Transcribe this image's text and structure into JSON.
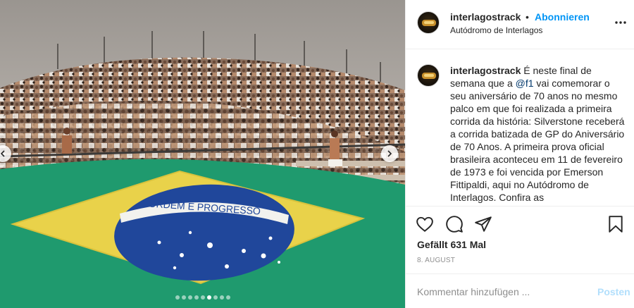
{
  "header": {
    "username": "interlagostrack",
    "separator": "•",
    "follow_label": "Abonnieren",
    "location": "Autódromo de Interlagos"
  },
  "caption": {
    "username": "interlagostrack",
    "text_before_mention": " É neste final de semana que a ",
    "mention": "@f1",
    "text_after_mention": " vai comemorar o seu aniversário de 70 anos no mesmo palco em que foi realizada a primeira corrida da história: Silverstone receberá a corrida batizada de GP do Aniversário de 70 Anos. A primeira prova oficial brasileira aconteceu em 11 de fevereiro de 1973 e foi vencida por Emerson Fittipaldi, aqui no Autódromo de Interlagos. Confira as"
  },
  "media": {
    "flag_motto": "ORDEM E PROGRESSO",
    "carousel_total": 9,
    "carousel_active": 5
  },
  "stats": {
    "likes": "Gefällt 631 Mal",
    "date": "8. AUGUST"
  },
  "comment": {
    "placeholder": "Kommentar hinzufügen ...",
    "post_label": "Posten"
  },
  "icons": {
    "like": "heart-icon",
    "comment": "comment-icon",
    "share": "paper-plane-icon",
    "save": "bookmark-icon",
    "more": "more-options-icon",
    "prev": "chevron-left-icon",
    "next": "chevron-right-icon"
  },
  "colors": {
    "accent": "#0095f6",
    "post_disabled": "#b2dffc",
    "flag_green": "#1f9a6e",
    "flag_yellow": "#e9d24a",
    "flag_blue": "#20479b"
  }
}
